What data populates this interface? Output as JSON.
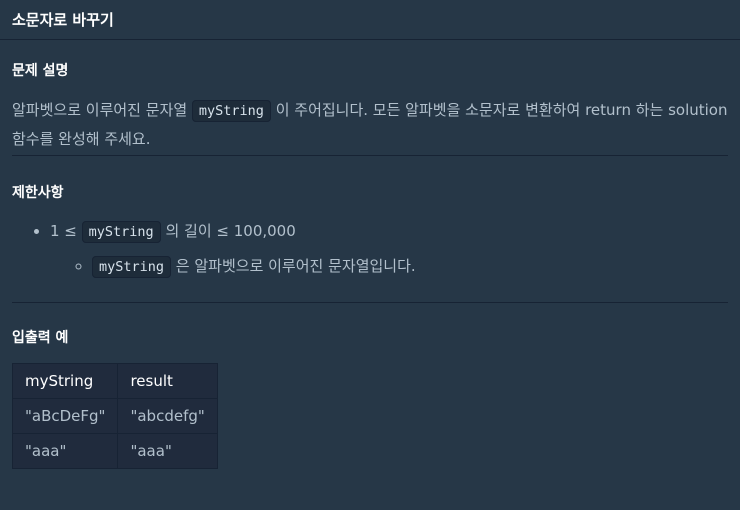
{
  "header": {
    "title": "소문자로 바꾸기"
  },
  "description": {
    "title": "문제 설명",
    "text_1": "알파벳으로 이루어진 문자열 ",
    "code": "myString",
    "text_2": " 이 주어집니다. 모든 알파벳을 소문자로 변환하여 return 하는 solution 함수를 완성해 주세요."
  },
  "limits": {
    "title": "제한사항",
    "item1_prefix": "1 ≤ ",
    "item1_code": "myString",
    "item1_suffix": " 의 길이 ≤ 100,000",
    "sub1_code": "myString",
    "sub1_suffix": " 은 알파벳으로 이루어진 문자열입니다."
  },
  "examples": {
    "title": "입출력 예",
    "headers": [
      "myString",
      "result"
    ],
    "rows": [
      [
        "\"aBcDeFg\"",
        "\"abcdefg\""
      ],
      [
        "\"aaa\"",
        "\"aaa\""
      ]
    ]
  }
}
